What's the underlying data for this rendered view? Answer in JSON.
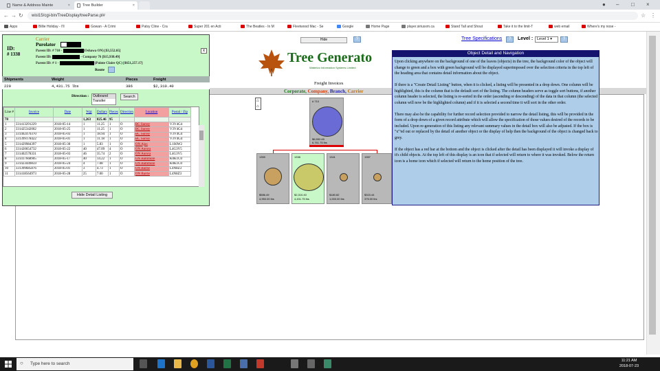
{
  "browser": {
    "tabs": [
      {
        "title": "Name & Address Mainte"
      },
      {
        "title": "Tree Builder"
      }
    ],
    "url": "wisl15/cgi-bin/TreeDisplay/treeParse.pl#",
    "bookmarks": [
      "Apps",
      "Billie Holiday - I'll",
      "Gowan - A Crimi",
      "Patsy Cline - Cra",
      "Super 201 en Acti",
      "The Beatles - In M",
      "Fleetwood Mac - Se",
      "Google",
      "Home Page",
      "player.siriusxm.ca",
      "Stand Tall and Shout",
      "Take it to the limit-T",
      "web email",
      "Where's my nose -"
    ]
  },
  "toolbar": {
    "hide_label": "Hide",
    "tree_spec_label": "Tree Specifications",
    "level_label": "Level :",
    "level_value": "Level 1",
    "help": "?"
  },
  "logo": {
    "title": "Tree Generato",
    "subtitle": "Waterloo Information Systems Limited"
  },
  "freight_title": "Freight Invoices",
  "legend": {
    "corporate": "Corporate,",
    "company": "Company,",
    "branch": "Branch,",
    "carrier": "Carrier"
  },
  "tree": {
    "root": {
      "id": "# 710",
      "amount": "$6,552.65",
      "weight": "6,761.75 lbs"
    },
    "children": [
      {
        "id": "1359",
        "amount": "$586.49",
        "weight": "4,950.00 lbs"
      },
      {
        "id": "1338",
        "amount": "$2,310.40",
        "weight": "4,431.75 lbs"
      },
      {
        "id": "1341",
        "amount": "$180.82",
        "weight": "1,000.00 lbs"
      },
      {
        "id": "1357",
        "amount": "$315.44",
        "weight": "375.00 lbs"
      }
    ]
  },
  "detail": {
    "category": "Carrier",
    "name": "Purolator",
    "id_label": "ID:",
    "id_value": "# 1338",
    "parent1": {
      "prefix": "Parent ID: # 710 -",
      "suffix": "(Oshawa ON) [$3,552.65]"
    },
    "parent2": {
      "prefix": "Parent ID:",
      "suffix": "- Company 76 [$15,938.49]"
    },
    "parent3": {
      "prefix": "Parent ID: # 1 -",
      "suffix": "(Pointe Claire QC) [$651,257.17]"
    },
    "route_label": "Route",
    "close": "x",
    "summary_headers": {
      "shipments": "Shipments",
      "weight": "Weight",
      "pieces": "Pieces",
      "freight": "Freight"
    },
    "summary_values": {
      "shipments": "220",
      "weight": "4,431.75 lbs",
      "pieces": "386",
      "freight": "$2,310.40"
    },
    "direction_label": "Direction :",
    "direction_options": [
      "Outbound",
      "Transfer"
    ],
    "search_label": "Search",
    "columns": [
      "Line #",
      "Invoice",
      "Date",
      "Wgt",
      "Dollars",
      "Pieces",
      "Direction",
      "Location",
      "Postal / Zip"
    ],
    "totals": {
      "line": "70",
      "wgt": "1,263",
      "dollars": "825.46",
      "pieces": "95"
    },
    "rows": [
      {
        "line": "1",
        "invoice": "331413291229",
        "date": "2018-05-14",
        "wgt": "1",
        "dollars": "11.25",
        "pieces": "1",
        "dir": "O",
        "loc": "BC Surrey",
        "zip": "V3V4G4"
      },
      {
        "line": "2",
        "invoice": "331425342002",
        "date": "2018-05-25",
        "wgt": "1",
        "dollars": "11.25",
        "pieces": "1",
        "dir": "O",
        "loc": "BC Surrey",
        "zip": "V3V4G4"
      },
      {
        "line": "3",
        "invoice": "331402470370",
        "date": "2018-05-03",
        "wgt": "1",
        "dollars": "18.94",
        "pieces": "1",
        "dir": "O",
        "loc": "BC Surrey",
        "zip": "V3V4G4"
      },
      {
        "line": "4",
        "invoice": "331399178422",
        "date": "2018-05-01",
        "wgt": "1",
        "dollars": "11.18",
        "pieces": "1",
        "dir": "O",
        "loc": "BC Surrey",
        "zip": "V3V4G4"
      },
      {
        "line": "5",
        "invoice": "331429984397",
        "date": "2018-05-30",
        "wgt": "1",
        "dollars": "5.83",
        "pieces": "1",
        "dir": "O",
        "loc": "ON Ajax",
        "zip": "L1S6W2"
      },
      {
        "line": "6",
        "invoice": "331420654732",
        "date": "2018-05-22",
        "wgt": "40",
        "dollars": "47.09",
        "pieces": "4",
        "dir": "O",
        "loc": "ON Aurora",
        "zip": "L4G3V5"
      },
      {
        "line": "7",
        "invoice": "331402578331",
        "date": "2018-05-03",
        "wgt": "46",
        "dollars": "35.74",
        "pieces": "2",
        "dir": "O",
        "loc": "ON Aurora",
        "zip": "L4G3V5"
      },
      {
        "line": "8",
        "invoice": "331417668905",
        "date": "2018-05-17",
        "wgt": "40",
        "dollars": "14.22",
        "pieces": "1",
        "dir": "O",
        "loc": "ON Baltimore",
        "zip": "K0K1C0"
      },
      {
        "line": "9",
        "invoice": "331423449859",
        "date": "2018-05-24",
        "wgt": "4",
        "dollars": "7.08",
        "pieces": "1",
        "dir": "O",
        "loc": "ON Baltimore",
        "zip": "K0K1C0"
      },
      {
        "line": "10",
        "invoice": "331399685876",
        "date": "2018-05-01",
        "wgt": "3",
        "dollars": "4.73",
        "pieces": "1",
        "dir": "O",
        "loc": "ON Barrie",
        "zip": "L4N8Z3"
      },
      {
        "line": "11",
        "invoice": "331418564973",
        "date": "2018-05-28",
        "wgt": "25",
        "dollars": "7.00",
        "pieces": "1",
        "dir": "O",
        "loc": "ON Barrie",
        "zip": "L4N8Z3"
      }
    ],
    "hide_button": "Hide Detail Listing"
  },
  "info": {
    "title": "Object Detail and Navigation",
    "paragraphs": [
      "Upon clicking anywhere on the background of one of the leaves (objects) in the tree, the background color of the object will change to green and a box with green background will be displayed superimposed over the selection criteria in the top left of the heading area that contains detail information about the object.",
      "If there is a \"Create Detail Listing\" button, when it is clicked, a listing will be presented in a drop down. One column will be highlighted, this is the column that is the default sort of the listing. The column headers serve as toggle sort buttons, if another column header is selected, the listing is re-sorted in the order (ascending or descending) of the data in that column (the selected column will now be the highlighted column) and if it is selected a second time it will sort in the other order.",
      "There may also be the capability for further record selection provided to narrow the detail listing, this will be provided in the form of a drop down of a given record attribute which will allow the specification of those values desired of the records to be included. Upon re-generation of this listing any relevant summary values in the detail box will also be adjusted. If the box is \"x\"'ed out or replaced by the detail of another object or the display of help then the background of the object is changed back to grey.",
      "If the object has a red bar at the bottom and the object is clicked after the detail has been displayed it will invoke a display of it's child objects. At the top left of this display is an icon that if selected will return to where it was invoked. Below the return icon is a home icon which if selected will return to the home position of the tree."
    ]
  },
  "taskbar": {
    "search_placeholder": "Type here to search",
    "time": "11:21 AM",
    "date": "2018-07-23"
  },
  "colors": {
    "detail_bg": "#c8f7c8",
    "info_bg": "#aecde8",
    "info_title_bg": "#14146e",
    "root_circle": "#6b6bd6",
    "child_circle": "#c8a060",
    "selected_circle": "#c9c96a",
    "location_highlight": "#f3a0a0"
  }
}
